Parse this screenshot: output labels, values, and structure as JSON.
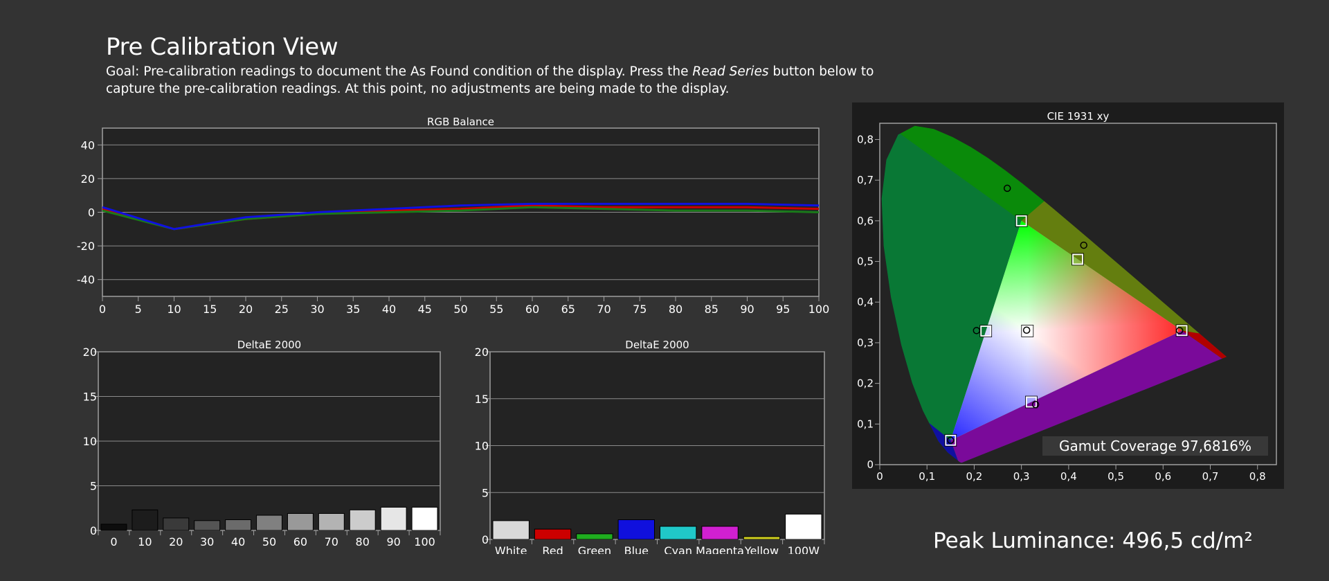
{
  "page": {
    "title": "Pre Calibration View",
    "goal_prefix": "Goal: Pre-calibration readings to document the As Found condition of the display. Press the ",
    "goal_emphasis": "Read Series",
    "goal_suffix": " button below to capture the pre-calibration readings. At this point, no adjustments are being made to the display.",
    "peak_luminance": "Peak Luminance: 496,5 cd/m²"
  },
  "colors": {
    "background": "#333333",
    "plot_bg": "#232323",
    "red": "#cc0000",
    "green": "#1a7a1a",
    "blue": "#1010e0"
  },
  "chart_data": [
    {
      "id": "rgb",
      "type": "line",
      "title": "RGB Balance",
      "x": [
        0,
        10,
        20,
        30,
        40,
        50,
        60,
        70,
        80,
        90,
        100
      ],
      "xticks": [
        "0",
        "5",
        "10",
        "15",
        "20",
        "25",
        "30",
        "35",
        "40",
        "45",
        "50",
        "55",
        "60",
        "65",
        "70",
        "75",
        "80",
        "85",
        "90",
        "95",
        "100"
      ],
      "yticks": [
        "40",
        "20",
        "0",
        "-20",
        "-40"
      ],
      "xlim": [
        0,
        100
      ],
      "ylim": [
        -50,
        50
      ],
      "grid": true,
      "series": [
        {
          "color": "#cc0000",
          "values": [
            2,
            -10,
            -4,
            -1,
            1,
            2,
            4,
            3,
            3,
            3,
            2
          ]
        },
        {
          "color": "#1a7a1a",
          "values": [
            1,
            -10,
            -4,
            -1,
            0,
            1,
            3,
            2,
            1,
            1,
            0
          ]
        },
        {
          "color": "#1010e0",
          "values": [
            3,
            -10,
            -3,
            0,
            2,
            4,
            5,
            5,
            5,
            5,
            4
          ]
        }
      ]
    },
    {
      "id": "grayscale",
      "type": "bar",
      "title": "DeltaE 2000",
      "categories": [
        "0",
        "10",
        "20",
        "30",
        "40",
        "50",
        "60",
        "70",
        "80",
        "90",
        "100"
      ],
      "values": [
        0.7,
        2.3,
        1.4,
        1.1,
        1.2,
        1.7,
        1.9,
        1.9,
        2.3,
        2.6,
        2.6
      ],
      "bar_colors": [
        "#0d0d0d",
        "#1c1c1c",
        "#3a3a3a",
        "#555555",
        "#6b6b6b",
        "#808080",
        "#999999",
        "#b3b3b3",
        "#cccccc",
        "#e6e6e6",
        "#ffffff"
      ],
      "yticks": [
        "20",
        "15",
        "10",
        "5",
        "0"
      ],
      "ylim": [
        0,
        20
      ],
      "grid": true
    },
    {
      "id": "colors",
      "type": "bar",
      "title": "DeltaE 2000",
      "categories": [
        "White",
        "Red",
        "Green",
        "Blue",
        "Cyan",
        "Magenta",
        "Yellow",
        "100W"
      ],
      "values": [
        2.0,
        1.1,
        0.6,
        2.1,
        1.4,
        1.4,
        0.3,
        2.7
      ],
      "bar_colors": [
        "#d9d9d9",
        "#cc0000",
        "#1fad1f",
        "#1010dd",
        "#20c8c8",
        "#d020d0",
        "#d0d020",
        "#ffffff"
      ],
      "yticks": [
        "20",
        "15",
        "10",
        "5",
        "0"
      ],
      "ylim": [
        0,
        20
      ],
      "grid": true
    },
    {
      "id": "cie",
      "type": "scatter",
      "title": "CIE 1931 xy",
      "xticks": [
        "0",
        "0,1",
        "0,2",
        "0,3",
        "0,4",
        "0,5",
        "0,6",
        "0,7",
        "0,8"
      ],
      "yticks": [
        "0,8",
        "0,7",
        "0,6",
        "0,5",
        "0,4",
        "0,3",
        "0,2",
        "0,1",
        "0"
      ],
      "xlim": [
        0,
        0.84
      ],
      "ylim": [
        0,
        0.84
      ],
      "locus": [
        [
          0.1741,
          0.005
        ],
        [
          0.174,
          0.005
        ],
        [
          0.1733,
          0.0048
        ],
        [
          0.1726,
          0.0048
        ],
        [
          0.1714,
          0.0051
        ],
        [
          0.1689,
          0.0069
        ],
        [
          0.144,
          0.0297
        ],
        [
          0.1241,
          0.0578
        ],
        [
          0.0913,
          0.1327
        ],
        [
          0.0687,
          0.2007
        ],
        [
          0.0454,
          0.295
        ],
        [
          0.0235,
          0.4127
        ],
        [
          0.0082,
          0.5384
        ],
        [
          0.0039,
          0.6548
        ],
        [
          0.0139,
          0.7502
        ],
        [
          0.0389,
          0.812
        ],
        [
          0.0743,
          0.8338
        ],
        [
          0.1142,
          0.8262
        ],
        [
          0.1547,
          0.8059
        ],
        [
          0.1929,
          0.7816
        ],
        [
          0.2296,
          0.7543
        ],
        [
          0.2658,
          0.7243
        ],
        [
          0.3016,
          0.6923
        ],
        [
          0.3373,
          0.6589
        ],
        [
          0.3731,
          0.6245
        ],
        [
          0.4087,
          0.5896
        ],
        [
          0.4441,
          0.5547
        ],
        [
          0.4788,
          0.5202
        ],
        [
          0.5125,
          0.4866
        ],
        [
          0.5448,
          0.4544
        ],
        [
          0.5752,
          0.4242
        ],
        [
          0.6029,
          0.3965
        ],
        [
          0.627,
          0.3725
        ],
        [
          0.6482,
          0.3514
        ],
        [
          0.6658,
          0.334
        ],
        [
          0.6915,
          0.3083
        ],
        [
          0.7347,
          0.2653
        ]
      ],
      "targets": [
        [
          0.64,
          0.33
        ],
        [
          0.3,
          0.6
        ],
        [
          0.15,
          0.06
        ],
        [
          0.3127,
          0.329
        ],
        [
          0.2246,
          0.3287
        ],
        [
          0.3209,
          0.1542
        ],
        [
          0.4193,
          0.5053
        ]
      ],
      "measured": [
        [
          0.635,
          0.33
        ],
        [
          0.27,
          0.68
        ],
        [
          0.15,
          0.06
        ],
        [
          0.311,
          0.331
        ],
        [
          0.205,
          0.33
        ],
        [
          0.33,
          0.148
        ],
        [
          0.432,
          0.54
        ]
      ],
      "gamut_label": "Gamut Coverage 97,6816%"
    }
  ]
}
